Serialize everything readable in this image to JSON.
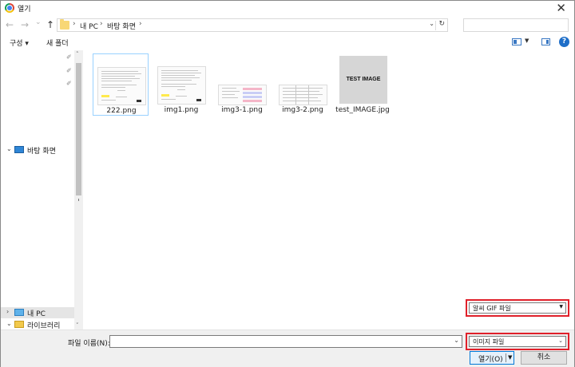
{
  "window": {
    "title": "열기",
    "close_glyph": "✕"
  },
  "nav": {
    "back_glyph": "←",
    "forward_glyph": "→",
    "recent_glyph": "⌄",
    "up_glyph": "↑",
    "breadcrumb": [
      "내 PC",
      "바탕 화면"
    ],
    "separator": "›",
    "dropdown_glyph": "⌄",
    "refresh_glyph": "↻",
    "search_placeholder": ""
  },
  "toolbar": {
    "organize_label": "구성 ▾",
    "new_folder_label": "새 폴더",
    "help_glyph": "?"
  },
  "sidebar": {
    "pin_glyph": "✐",
    "items": [
      {
        "label": "바탕 화면",
        "chevron": "⌄",
        "icon": "desktop-icon"
      },
      {
        "label": "내 PC",
        "chevron": "›",
        "icon": "pc-icon"
      },
      {
        "label": "라이브러리",
        "chevron": "⌄",
        "icon": "library-icon"
      }
    ],
    "scroll_up": "˄",
    "scroll_down": "˅"
  },
  "files": [
    {
      "name": "222.png",
      "kind": "doc-image",
      "selected": true
    },
    {
      "name": "img1.png",
      "kind": "doc-image",
      "selected": false
    },
    {
      "name": "img3-1.png",
      "kind": "table-image",
      "selected": false
    },
    {
      "name": "img3-2.png",
      "kind": "table-image",
      "selected": false
    },
    {
      "name": "test_IMAGE.jpg",
      "kind": "gray-image",
      "thumb_text": "TEST IMAGE",
      "selected": false
    }
  ],
  "format_dropdown": {
    "value": "알씨 GIF 파일",
    "arrow": "▼"
  },
  "footer": {
    "filename_label": "파일 이름(N):",
    "filename_value": "",
    "filename_arrow": "⌄",
    "filetype_value": "이미지 파일",
    "filetype_arrow": "⌄",
    "open_label": "열기(O)",
    "open_arrow": "▼",
    "cancel_label": "취소"
  },
  "colors": {
    "highlight_border": "#e0202a",
    "accent": "#0078d7",
    "selection": "#99d1ff"
  }
}
